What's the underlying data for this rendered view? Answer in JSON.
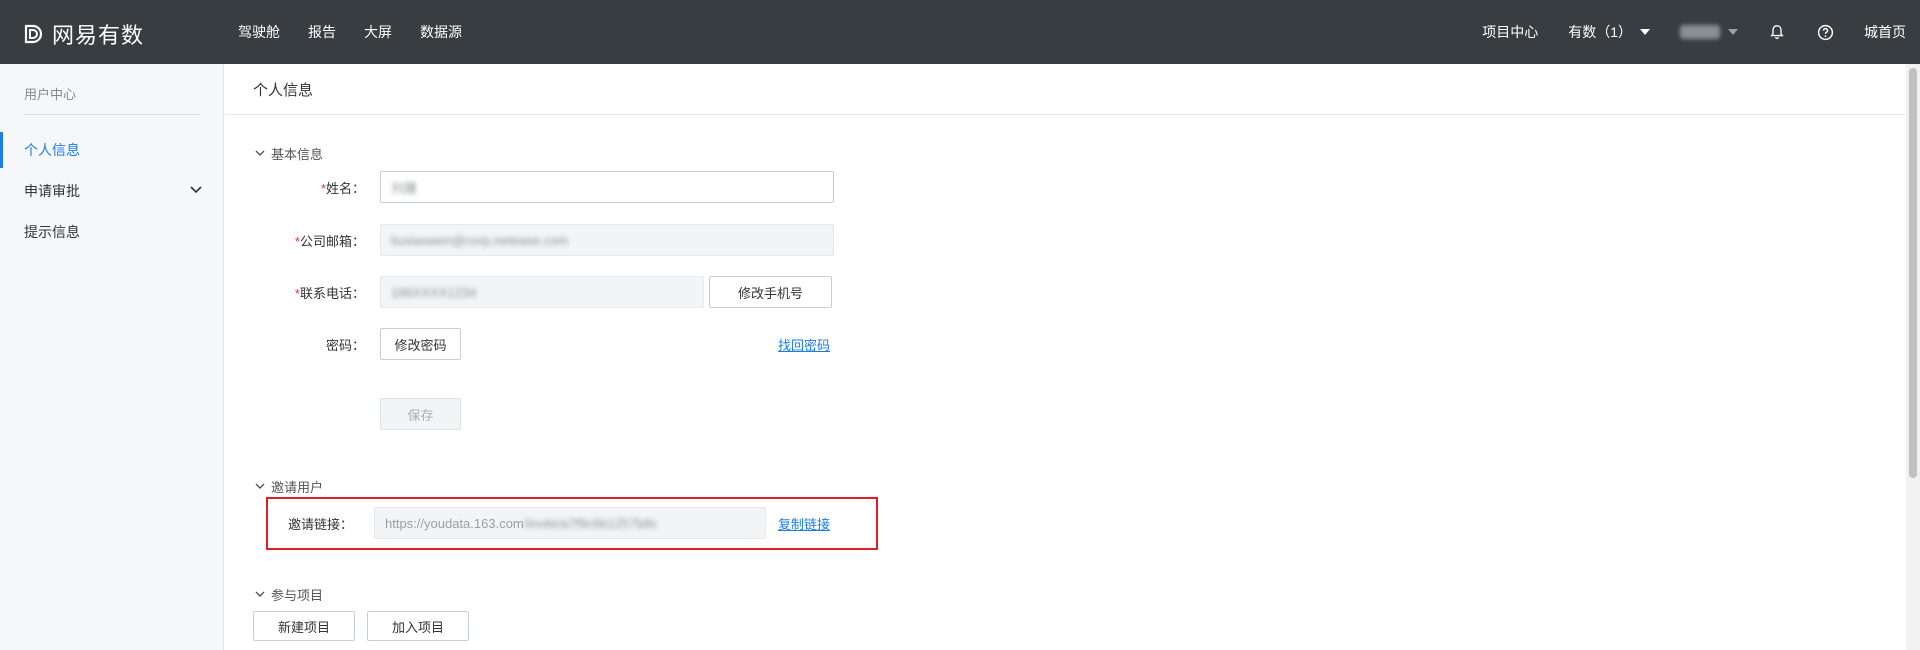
{
  "topbar": {
    "logo_text": "网易有数",
    "nav": [
      "驾驶舱",
      "报告",
      "大屏",
      "数据源"
    ],
    "project_center": "项目中心",
    "org_switch": "有数（1）",
    "home": "城首页"
  },
  "sidebar": {
    "title": "用户中心",
    "items": [
      {
        "label": "个人信息"
      },
      {
        "label": "申请审批"
      },
      {
        "label": "提示信息"
      }
    ]
  },
  "main": {
    "page_title": "个人信息",
    "basic": {
      "section_title": "基本信息",
      "name_label": "姓名：",
      "name_value": "刘晟",
      "email_label": "公司邮箱：",
      "email_value": "liuxiaowen@corp.netease.com",
      "phone_label": "联系电话：",
      "phone_value": "186XXXX1234",
      "change_phone_btn": "修改手机号",
      "password_label": "密码：",
      "change_password_btn": "修改密码",
      "retrieve_password_link": "找回密码",
      "save_btn": "保存",
      "required_mark": "*"
    },
    "invite": {
      "section_title": "邀请用户",
      "link_label": "邀请链接：",
      "link_visible": "https://youdata.163.com",
      "link_blurred": "/invite/a7f9c6b1257b8c",
      "copy_link": "复制链接"
    },
    "projects": {
      "section_title": "参与项目",
      "new_project_btn": "新建项目",
      "join_project_btn": "加入项目"
    }
  },
  "colors": {
    "topbar_bg": "#373d41",
    "accent": "#1a7ee6",
    "required": "#e5343a",
    "highlight_box": "#e11d25"
  }
}
